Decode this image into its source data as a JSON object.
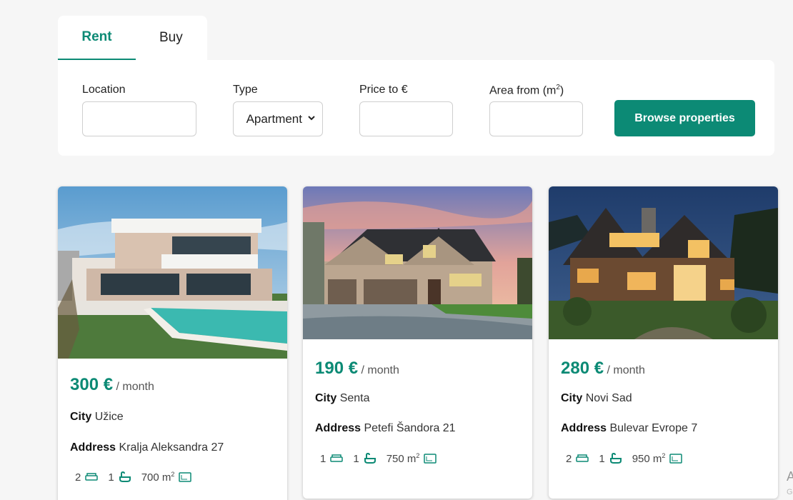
{
  "tabs": [
    {
      "label": "Rent",
      "active": true
    },
    {
      "label": "Buy",
      "active": false
    }
  ],
  "search": {
    "location_label": "Location",
    "location_value": "",
    "type_label": "Type",
    "type_value": "Apartment",
    "price_label": "Price to €",
    "price_value": "",
    "area_label": "Area from (m",
    "area_sup": "2",
    "area_label_end": ")",
    "area_value": "",
    "browse_label": "Browse properties"
  },
  "colors": {
    "accent": "#0c8a75",
    "background": "#f6f6f6"
  },
  "listings": [
    {
      "price": "300 €",
      "period": "/ month",
      "city_label": "City",
      "city": "Užice",
      "address_label": "Address",
      "address": "Kralja Aleksandra 27",
      "beds": "2",
      "baths": "1",
      "area": "700 m",
      "area_sup": "2",
      "photo": "modern white villa with pool"
    },
    {
      "price": "190 €",
      "period": "/ month",
      "city_label": "City",
      "city": "Senta",
      "address_label": "Address",
      "address": "Petefi Šandora 21",
      "beds": "1",
      "baths": "1",
      "area": "750 m",
      "area_sup": "2",
      "photo": "craftsman house at sunset"
    },
    {
      "price": "280 €",
      "period": "/ month",
      "city_label": "City",
      "city": "Novi Sad",
      "address_label": "Address",
      "address": "Bulevar Evrope 7",
      "beds": "2",
      "baths": "1",
      "area": "950 m",
      "area_sup": "2",
      "photo": "lit wooden house at dusk"
    }
  ],
  "icons": [
    "bed-icon",
    "bath-icon",
    "area-icon",
    "chevron-down-icon"
  ],
  "edge_text": {
    "top": "A",
    "bottom": "G"
  }
}
